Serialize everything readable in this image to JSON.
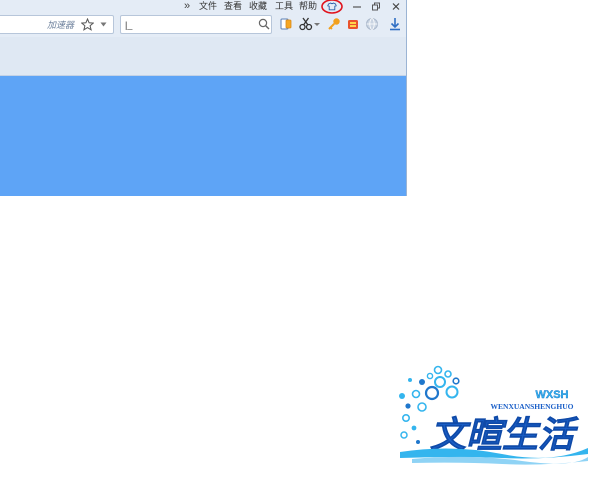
{
  "menubar": {
    "more_icon": "double-chevron-right-icon",
    "items": [
      "文件",
      "查看",
      "收藏",
      "工具",
      "帮助"
    ],
    "skin_icon": "tshirt-skin-icon",
    "window_controls": [
      "minimize-icon",
      "restore-icon",
      "close-icon"
    ],
    "skin_highlight_color": "#e0141e"
  },
  "toolbar": {
    "address_value": "",
    "accelerator_label": "加速器",
    "star_icon": "star-outline-icon",
    "search_placeholder": "",
    "search_value": "|_",
    "icons": [
      "reader-mode-icon",
      "scissors-icon",
      "key-icon",
      "red-sign-icon",
      "globe-icon",
      "download-icon"
    ]
  },
  "content": {
    "color": "#5ea4f6"
  },
  "watermark": {
    "brand_cn": "文暄生活",
    "brand_abbr": "WXSH",
    "brand_pinyin": "WENXUANSHENGHUO",
    "color": "#1a5fc8"
  }
}
